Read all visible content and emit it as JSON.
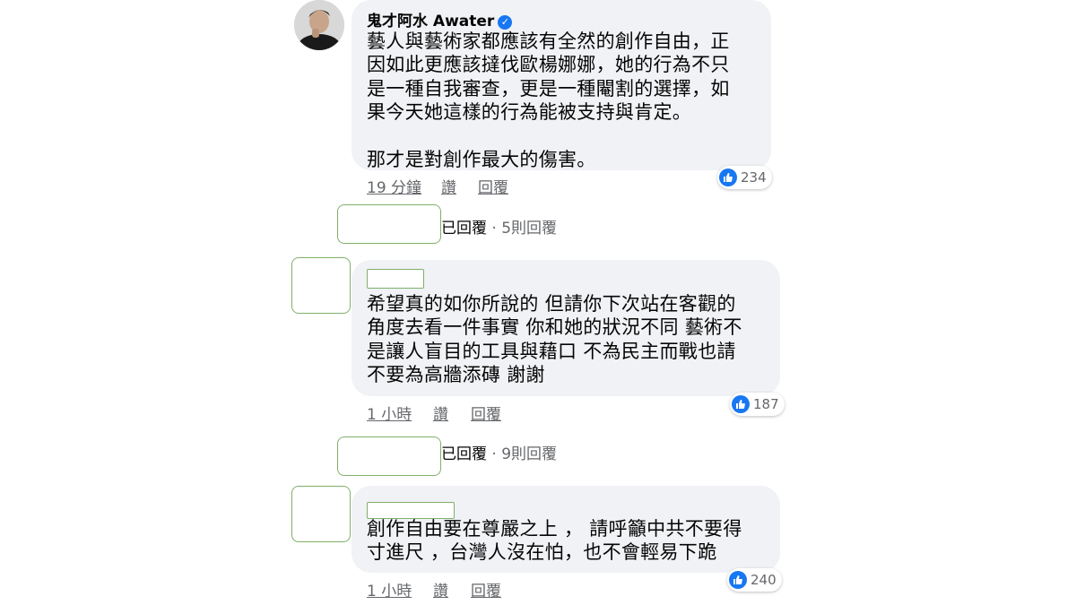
{
  "comments": [
    {
      "author": "鬼才阿水 Awater",
      "text": "藝人與藝術家都應該有全然的創作自由，正\n因如此更應該撻伐歐楊娜娜，她的行為不只\n是一種自我審查，更是一種閹割的選擇，如\n果今天她這樣的行為能被支持與肯定。\n\n那才是對創作最大的傷害。",
      "time": "19 分鐘",
      "like_label": "讚",
      "reply_label": "回覆",
      "reactions": "234"
    },
    {
      "text": "希望真的如你所說的 但請你下次站在客觀的\n角度去看一件事實 你和她的狀況不同 藝術不\n是讓人盲目的工具與藉口 不為民主而戰也請\n不要為高牆添磚 謝謝",
      "time": "1 小時",
      "like_label": "讚",
      "reply_label": "回覆",
      "reactions": "187"
    },
    {
      "text": "創作自由要在尊嚴之上 ， 請呼籲中共不要得\n寸進尺 ，台灣人沒在怕，也不會輕易下跪",
      "time": "1 小時",
      "like_label": "讚",
      "reply_label": "回覆",
      "reactions": "240"
    }
  ],
  "reply_threads": [
    {
      "label": "已回覆",
      "count": "5則回覆"
    },
    {
      "label": "已回覆",
      "count": "9則回覆"
    }
  ],
  "icons": {
    "like": "thumbs-up-icon",
    "verified": "verified-badge-icon"
  },
  "colors": {
    "like_blue": "#1877f2",
    "bubble": "#f0f2f5",
    "meta": "#65676b"
  }
}
